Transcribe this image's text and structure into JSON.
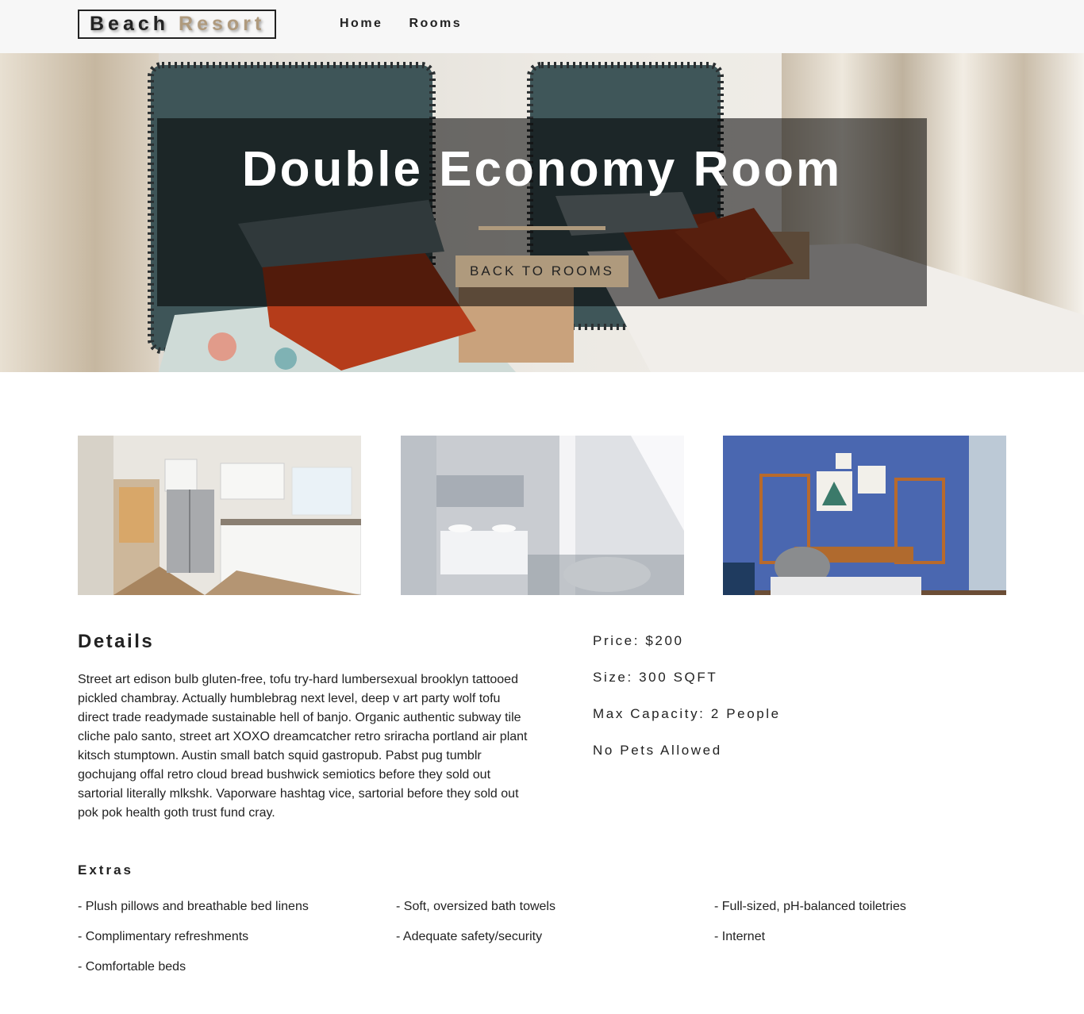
{
  "navbar": {
    "logo_word1": "Beach",
    "logo_word2": "Resort",
    "links": [
      "Home",
      "Rooms"
    ]
  },
  "hero": {
    "title": "Double Economy Room",
    "button": "BACK TO ROOMS"
  },
  "colors": {
    "accent": "#af9a7d",
    "text": "#222222",
    "navbar_bg": "#f7f7f7"
  },
  "gallery": [
    "kitchen",
    "bathroom",
    "study room"
  ],
  "details": {
    "title": "Details",
    "description": "Street art edison bulb gluten-free, tofu try-hard lumbersexual brooklyn tattooed pickled chambray. Actually humblebrag next level, deep v art party wolf tofu direct trade readymade sustainable hell of banjo. Organic authentic subway tile cliche palo santo, street art XOXO dreamcatcher retro sriracha portland air plant kitsch stumptown. Austin small batch squid gastropub. Pabst pug tumblr gochujang offal retro cloud bread bushwick semiotics before they sold out sartorial literally mlkshk. Vaporware hashtag vice, sartorial before they sold out pok pok health goth trust fund cray."
  },
  "info": {
    "price": "Price: $200",
    "size": "Size: 300 SQFT",
    "capacity": "Max Capacity: 2 People",
    "pets": "No Pets Allowed"
  },
  "extras": {
    "title": "Extras",
    "items": [
      "- Plush pillows and breathable bed linens",
      "- Soft, oversized bath towels",
      "- Full-sized, pH-balanced toiletries",
      "- Complimentary refreshments",
      "- Adequate safety/security",
      "- Internet",
      "- Comfortable beds"
    ]
  }
}
